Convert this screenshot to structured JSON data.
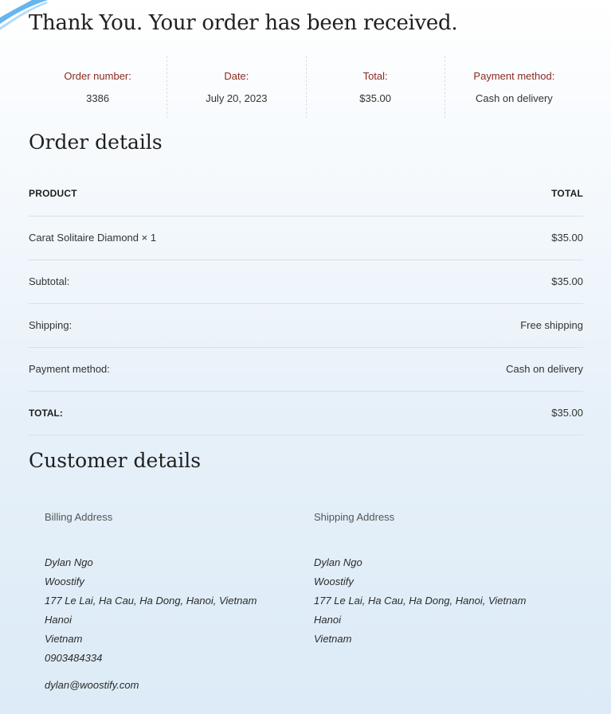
{
  "header": {
    "title": "Thank You. Your order has been received."
  },
  "overview": [
    {
      "label": "Order number:",
      "value": "3386"
    },
    {
      "label": "Date:",
      "value": "July 20, 2023"
    },
    {
      "label": "Total:",
      "value": "$35.00"
    },
    {
      "label": "Payment method:",
      "value": "Cash on delivery"
    }
  ],
  "order_details": {
    "title": "Order details",
    "col_product": "PRODUCT",
    "col_total": "TOTAL",
    "rows": [
      {
        "label": "Carat Solitaire Diamond × 1",
        "value": "$35.00"
      },
      {
        "label": "Subtotal:",
        "value": "$35.00"
      },
      {
        "label": "Shipping:",
        "value": "Free shipping"
      },
      {
        "label": "Payment method:",
        "value": "Cash on delivery"
      },
      {
        "label": "TOTAL:",
        "value": "$35.00"
      }
    ]
  },
  "customer_details": {
    "title": "Customer details",
    "billing": {
      "title": "Billing Address",
      "name": "Dylan Ngo",
      "company": "Woostify",
      "street": "177 Le Lai, Ha Cau, Ha Dong, Hanoi, Vietnam",
      "city": "Hanoi",
      "country": "Vietnam",
      "phone": "0903484334",
      "email": "dylan@woostify.com"
    },
    "shipping": {
      "title": "Shipping Address",
      "name": "Dylan Ngo",
      "company": "Woostify",
      "street": "177 Le Lai, Ha Cau, Ha Dong, Hanoi, Vietnam",
      "city": "Hanoi",
      "country": "Vietnam"
    }
  },
  "colors": {
    "accent_label": "#8a2b1f",
    "divider": "#dcdfe3"
  }
}
